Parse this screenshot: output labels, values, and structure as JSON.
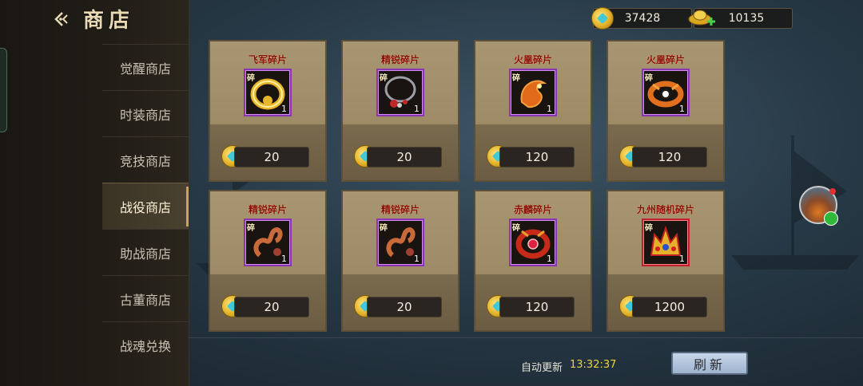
{
  "header": {
    "title": "商店",
    "back_icon": "back-arrow-icon"
  },
  "sidebar": {
    "items": [
      {
        "label": "觉醒商店",
        "active": false
      },
      {
        "label": "时装商店",
        "active": false
      },
      {
        "label": "竞技商店",
        "active": false
      },
      {
        "label": "战役商店",
        "active": true
      },
      {
        "label": "助战商店",
        "active": false
      },
      {
        "label": "古董商店",
        "active": false
      },
      {
        "label": "战魂兑换",
        "active": false
      }
    ]
  },
  "currency": {
    "coins": "37428",
    "ingots": "10135",
    "coin_icon": "coin-icon",
    "ingot_icon": "gold-ingot-icon"
  },
  "shop": {
    "fragment_tag": "碎",
    "items": [
      {
        "name": "飞军碎片",
        "icon": "gold-bracelet-icon",
        "count": "1",
        "price": "20"
      },
      {
        "name": "精锐碎片",
        "icon": "gem-necklace-icon",
        "count": "1",
        "price": "20"
      },
      {
        "name": "火凰碎片",
        "icon": "fire-phoenix-icon",
        "count": "1",
        "price": "120"
      },
      {
        "name": "火凰碎片",
        "icon": "phoenix-ring-icon",
        "count": "1",
        "price": "120"
      },
      {
        "name": "精锐碎片",
        "icon": "copper-ornament-icon",
        "count": "1",
        "price": "20"
      },
      {
        "name": "精锐碎片",
        "icon": "copper-ornament-icon",
        "count": "1",
        "price": "20"
      },
      {
        "name": "赤麟碎片",
        "icon": "ruby-ring-icon",
        "count": "1",
        "price": "120"
      },
      {
        "name": "九州随机碎片",
        "icon": "golden-crown-icon",
        "count": "1",
        "price": "1200"
      }
    ]
  },
  "footer": {
    "auto_refresh_label": "自动更新",
    "auto_refresh_time": "13:32:37",
    "refresh_button": "刷新"
  },
  "colors": {
    "item_name": "#8a1010",
    "rare_frame": "#8a36b0",
    "time_text": "#e8d640"
  }
}
